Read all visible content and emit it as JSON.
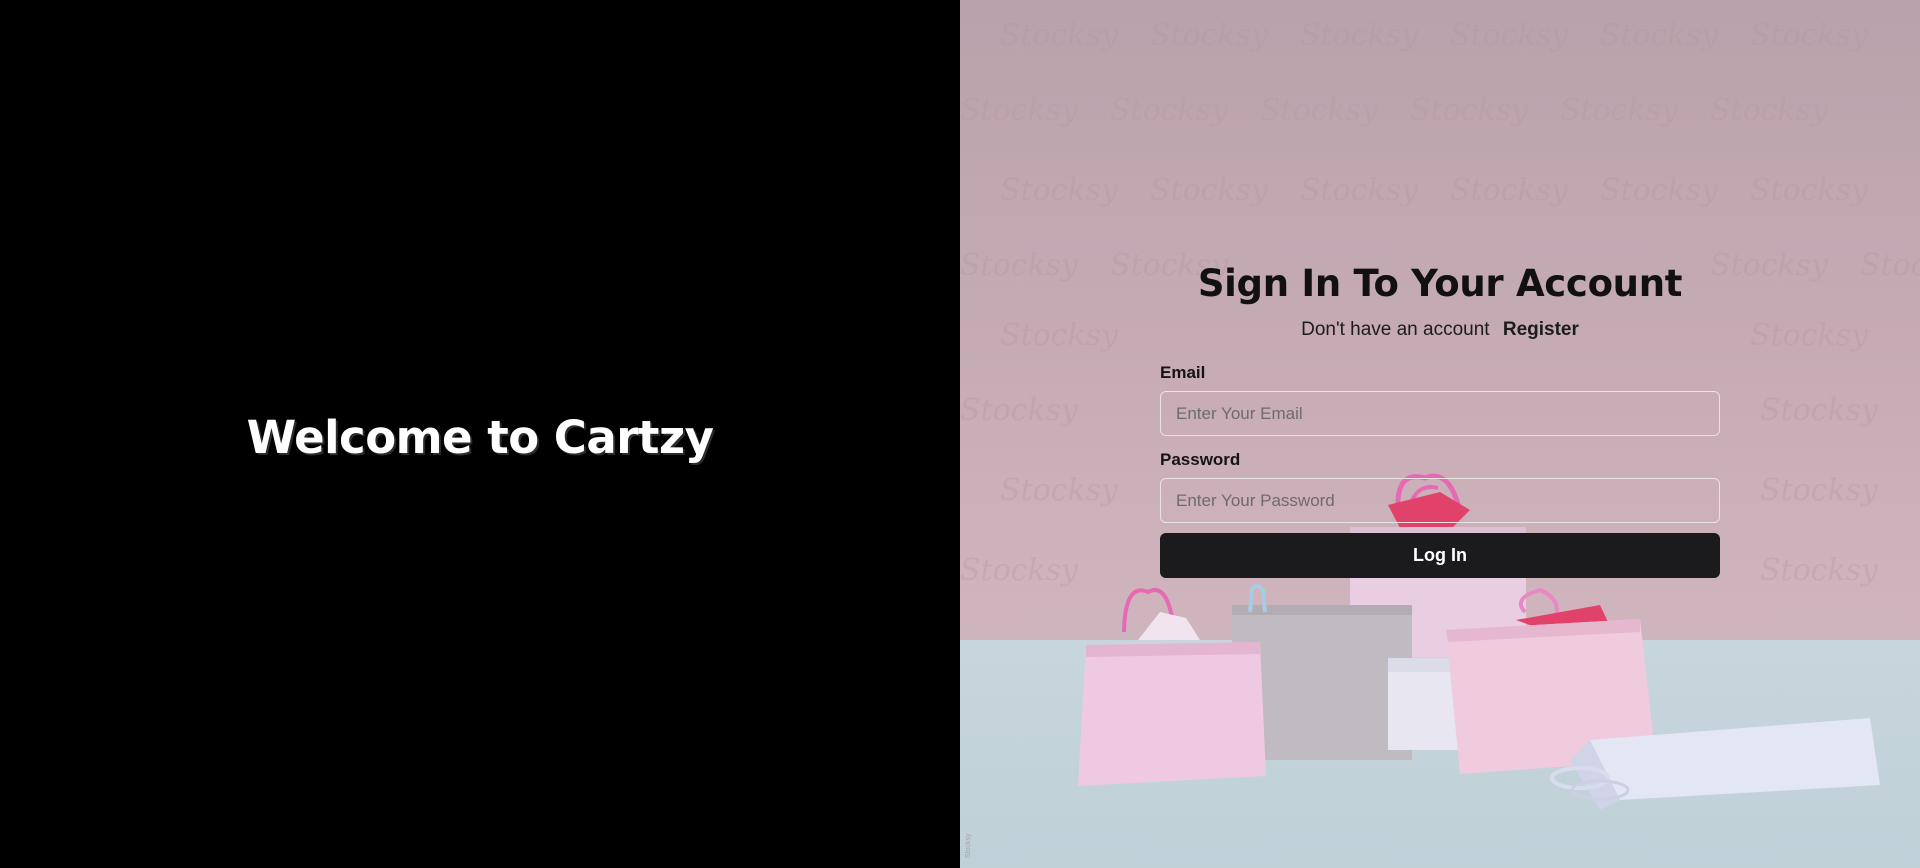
{
  "hero": {
    "welcome_text": "Welcome to Cartzy"
  },
  "form": {
    "title": "Sign In To Your Account",
    "no_account_text": "Don't have an account",
    "register_link": "Register",
    "email_label": "Email",
    "email_placeholder": "Enter Your Email",
    "email_value": "",
    "password_label": "Password",
    "password_placeholder": "Enter Your Password",
    "password_value": "",
    "submit_label": "Log In"
  },
  "background": {
    "image_subject": "pink-shopping-bags-photo",
    "side_watermark": "Stocksy"
  },
  "colors": {
    "left_panel": "#000000",
    "button": "#1b1b1d",
    "wall": "#c6abb4",
    "floor": "#c7d6dc"
  }
}
